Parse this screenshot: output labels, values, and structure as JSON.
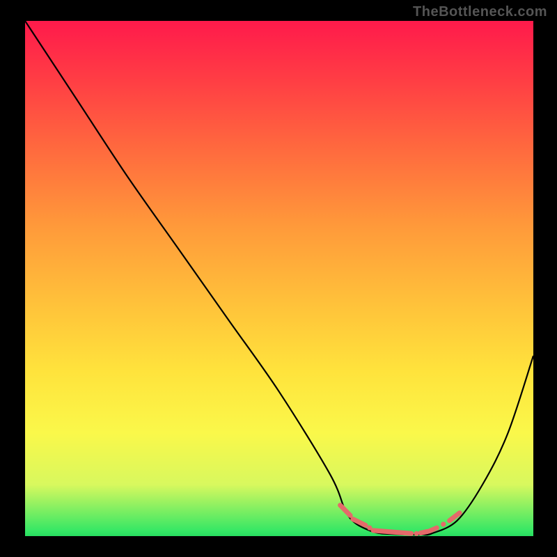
{
  "watermark": "TheBottleneck.com",
  "chart_data": {
    "type": "line",
    "title": "",
    "xlabel": "",
    "ylabel": "",
    "xlim": [
      0,
      100
    ],
    "ylim": [
      0,
      100
    ],
    "series": [
      {
        "name": "curve",
        "x": [
          0,
          10,
          20,
          30,
          40,
          50,
          60,
          63,
          65,
          68,
          70,
          72,
          75,
          78,
          80,
          85,
          90,
          95,
          100
        ],
        "values": [
          100,
          85,
          70,
          56,
          42,
          28,
          12,
          5,
          2.5,
          1,
          0.5,
          0.4,
          0.3,
          0.3,
          0.5,
          3,
          10,
          20,
          35
        ]
      }
    ],
    "highlight_segments": [
      {
        "x": [
          62,
          64
        ],
        "y": [
          6,
          4
        ]
      },
      {
        "x": [
          64.5,
          67
        ],
        "y": [
          3.3,
          2.1
        ]
      },
      {
        "x": [
          68.5,
          76
        ],
        "y": [
          1.1,
          0.5
        ]
      },
      {
        "x": [
          77.8,
          79.2
        ],
        "y": [
          0.6,
          0.9
        ]
      },
      {
        "x": [
          79.6,
          81.0
        ],
        "y": [
          1.0,
          1.6
        ]
      },
      {
        "x": [
          83.5,
          85.5
        ],
        "y": [
          3.0,
          4.5
        ]
      }
    ],
    "highlight_points": [
      {
        "x": 67.8,
        "y": 1.6
      },
      {
        "x": 77.0,
        "y": 0.5
      },
      {
        "x": 82.3,
        "y": 2.3
      }
    ],
    "background_gradient": {
      "top": "#ff1a4b",
      "mid": "#ffe33c",
      "bottom": "#27dd60"
    }
  }
}
